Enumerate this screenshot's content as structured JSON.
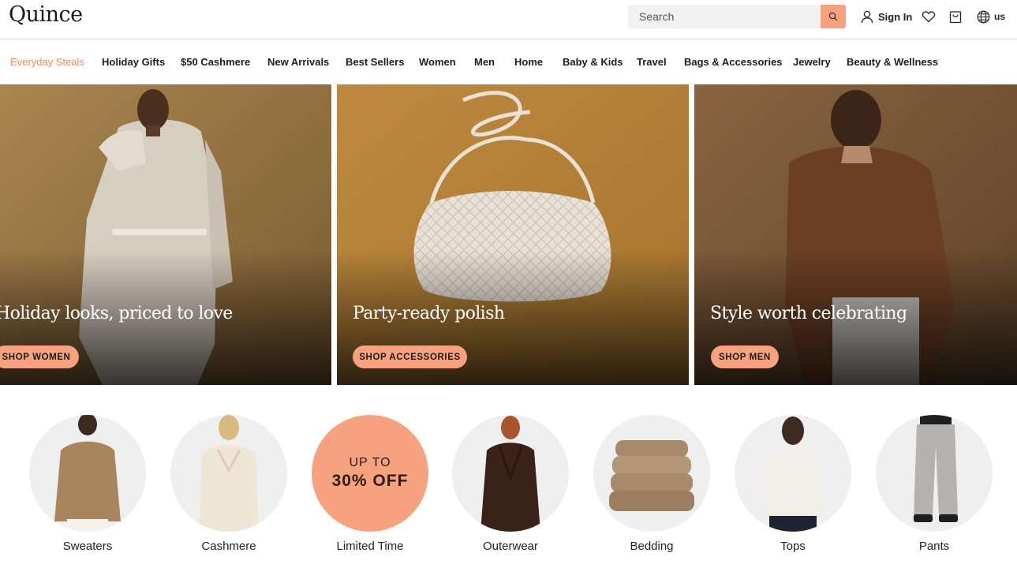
{
  "brand": {
    "logo": "Quince"
  },
  "header": {
    "search_placeholder": "Search",
    "sign_in_label": "Sign In",
    "region_label": "us"
  },
  "nav": {
    "items": [
      {
        "label": "Everyday Steals"
      },
      {
        "label": "Holiday Gifts"
      },
      {
        "label": "$50 Cashmere"
      },
      {
        "label": "New Arrivals"
      },
      {
        "label": "Best Sellers"
      },
      {
        "label": "Women"
      },
      {
        "label": "Men"
      },
      {
        "label": "Home"
      },
      {
        "label": "Baby & Kids"
      },
      {
        "label": "Travel"
      },
      {
        "label": "Bags & Accessories"
      },
      {
        "label": "Jewelry"
      },
      {
        "label": "Beauty & Wellness"
      }
    ]
  },
  "hero": [
    {
      "title": "Holiday looks, priced to love",
      "button": "SHOP WOMEN"
    },
    {
      "title": "Party-ready polish",
      "button": "SHOP ACCESSORIES"
    },
    {
      "title": "Style worth celebrating",
      "button": "SHOP MEN"
    }
  ],
  "categories": [
    {
      "label": "Sweaters"
    },
    {
      "label": "Cashmere"
    },
    {
      "label": "Limited Time",
      "promo_top": "UP TO",
      "promo_main": "30% OFF"
    },
    {
      "label": "Outerwear"
    },
    {
      "label": "Bedding"
    },
    {
      "label": "Tops"
    },
    {
      "label": "Pants"
    }
  ],
  "colors": {
    "accent": "#f6a27f",
    "nav_highlight": "#ee8c63"
  }
}
